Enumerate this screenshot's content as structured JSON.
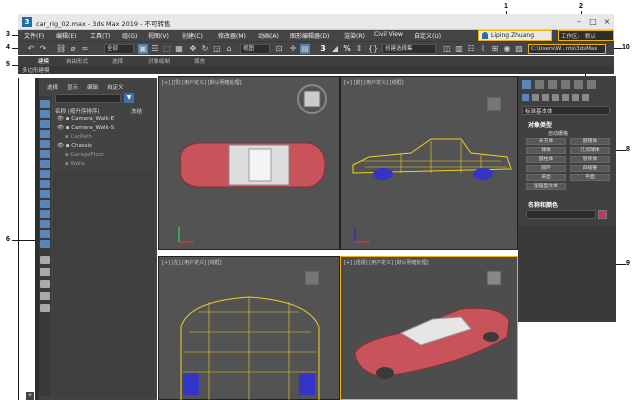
{
  "window": {
    "title": "car_rig_02.max - 3ds Max 2019 - 不可转售",
    "user": "Liping Zhuang",
    "workspace_label": "工作区:",
    "workspace_value": "默认",
    "path": "C:\\Users\\W...nts\\3dsMax"
  },
  "menu": [
    "文件(F)",
    "编辑(E)",
    "工具(T)",
    "组(G)",
    "视图(V)",
    "创建(C)",
    "修改器(M)",
    "动画(A)",
    "图形编辑器(D)",
    "渲染(R)",
    "Civil View",
    "自定义(U)"
  ],
  "toolbar": {
    "selection_filter": "全部",
    "ref_coord": "视图",
    "named_selection": "创建选择集"
  },
  "ribbon": {
    "tabs": [
      "建模",
      "自由形式",
      "选择",
      "对象绘制",
      "填充"
    ],
    "subtab": "多边形建模"
  },
  "scene_explorer": {
    "tabs": [
      "选择",
      "显示",
      "编辑",
      "自定义"
    ],
    "column_header": "名称 (按升序排序)",
    "freeze_label": "冻结",
    "rows": [
      "Camera_Walk-E",
      "Camera_Walk-S",
      "CarPath",
      "Chassis",
      "GarageFloor",
      "Walls"
    ]
  },
  "viewports": [
    {
      "label": "[+] [顶] [用户定义] [默认明暗处理]"
    },
    {
      "label": "[+] [前] [用户定义] [线框]"
    },
    {
      "label": "[+] [左] [用户定义] [线框]"
    },
    {
      "label": "[+] [透视] [用户定义] [默认明暗处理]"
    }
  ],
  "command_panel": {
    "category": "标准基本体",
    "rollout_title": "对象类型",
    "autogrid": "自动栅格",
    "buttons": [
      "长方体",
      "圆锥体",
      "球体",
      "几何球体",
      "圆柱体",
      "管状体",
      "圆环",
      "四棱锥",
      "茶壶",
      "平面",
      "加强型文本"
    ],
    "name_rollout": "名称和颜色",
    "object_color": "#c8346a"
  },
  "annotations": [
    "1",
    "2",
    "3",
    "4",
    "5",
    "6",
    "7",
    "8",
    "9",
    "10"
  ],
  "colors": {
    "car_body": "#c8535a",
    "wire": "#f0d020",
    "wheels": "#3434c8",
    "viewport_bg": "#555555"
  }
}
